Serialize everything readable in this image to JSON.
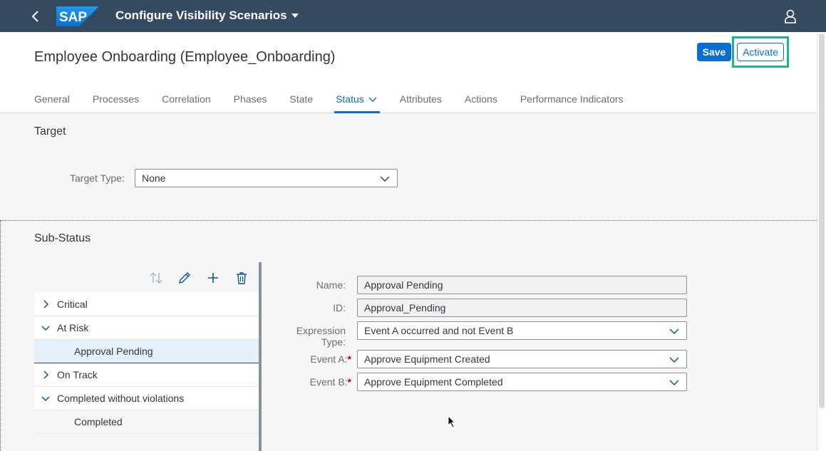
{
  "shell": {
    "logo_text": "SAP",
    "title": "Configure Visibility Scenarios"
  },
  "header": {
    "title": "Employee Onboarding (Employee_Onboarding)",
    "save_label": "Save",
    "activate_label": "Activate"
  },
  "tabs": [
    {
      "label": "General"
    },
    {
      "label": "Processes"
    },
    {
      "label": "Correlation"
    },
    {
      "label": "Phases"
    },
    {
      "label": "State"
    },
    {
      "label": "Status"
    },
    {
      "label": "Attributes"
    },
    {
      "label": "Actions"
    },
    {
      "label": "Performance Indicators"
    }
  ],
  "target": {
    "section_title": "Target",
    "type_label": "Target Type:",
    "type_value": "None"
  },
  "sub_status": {
    "section_title": "Sub-Status",
    "tree": [
      {
        "label": "Critical"
      },
      {
        "label": "At Risk"
      },
      {
        "label": "Approval Pending"
      },
      {
        "label": "On Track"
      },
      {
        "label": "Completed without violations"
      },
      {
        "label": "Completed"
      }
    ]
  },
  "form": {
    "name_label": "Name:",
    "name_value": "Approval Pending",
    "id_label": "ID:",
    "id_value": "Approval_Pending",
    "expr_label_1": "Expression",
    "expr_label_2": "Type:",
    "expr_value": "Event A occurred and not Event B",
    "event_a_label": "Event A:",
    "event_a_value": "Approve Equipment Created",
    "event_b_label": "Event B:",
    "event_b_value": "Approve Equipment Completed",
    "required_mark": "*"
  },
  "colors": {
    "shell_bg": "#354a5f",
    "accent": "#0a6ed1",
    "highlight": "#1db39a"
  }
}
